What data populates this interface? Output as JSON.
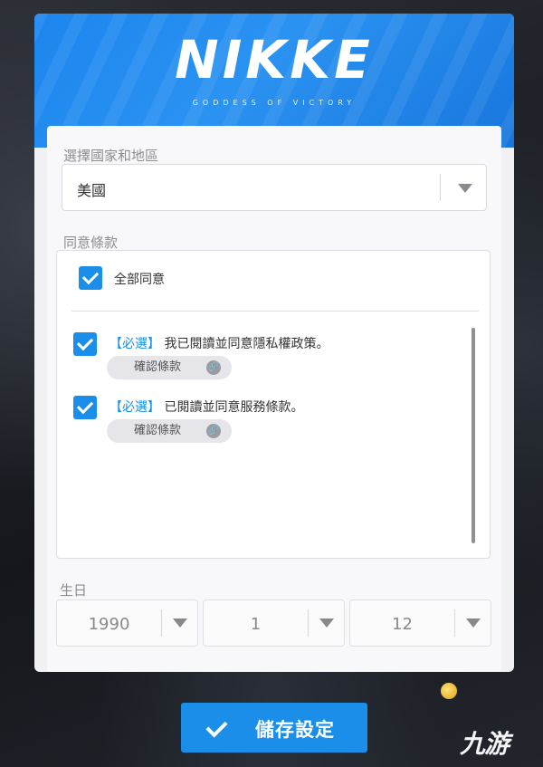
{
  "logo": {
    "title": "NIKKE",
    "subtitle": "GODDESS OF VICTORY"
  },
  "region": {
    "label": "選擇國家和地區",
    "selected": "美國"
  },
  "terms": {
    "label": "同意條款",
    "agree_all": "全部同意",
    "items": [
      {
        "tag": "【必選】",
        "text": "我已閱讀並同意隱私權政策。",
        "link_label": "確認條款",
        "checked": true
      },
      {
        "tag": "【必選】",
        "text": "已閱讀並同意服務條款。",
        "link_label": "確認條款",
        "checked": true
      }
    ]
  },
  "birthday": {
    "label": "生日",
    "year": "1990",
    "month": "1",
    "day": "12"
  },
  "save_button": {
    "label": "儲存設定"
  },
  "watermark": {
    "text": "九游"
  },
  "colors": {
    "accent": "#1a8ee8",
    "banner": "#1c86ef"
  },
  "icons": [
    "check-icon",
    "chevron-down-icon",
    "link-icon"
  ]
}
